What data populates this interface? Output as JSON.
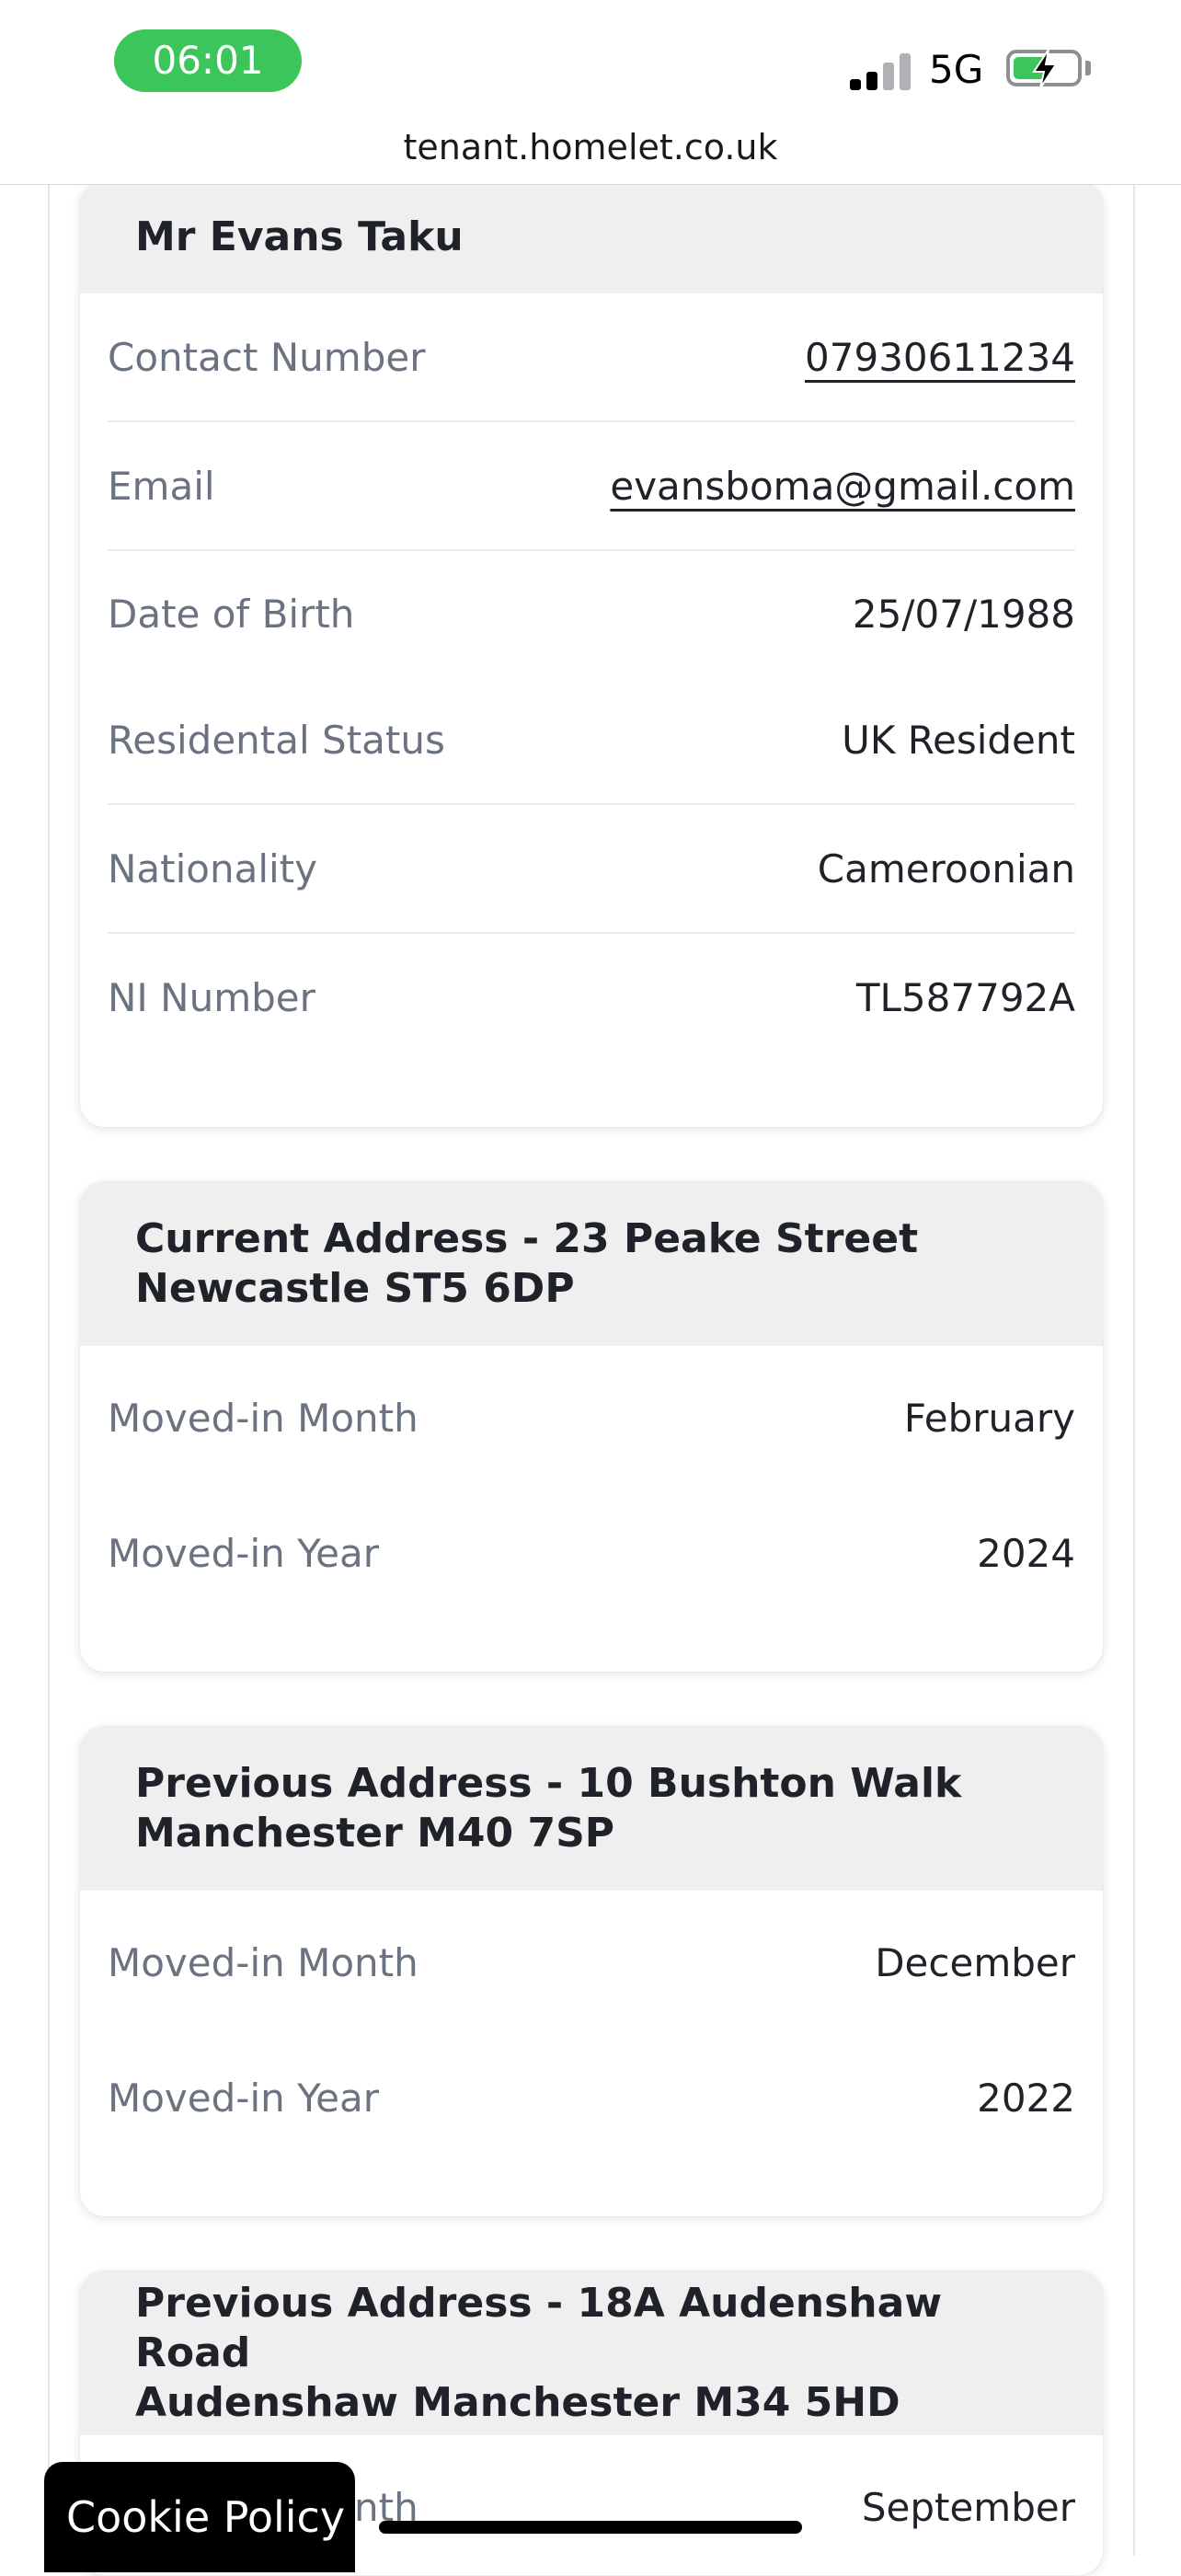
{
  "status_bar": {
    "time": "06:01",
    "network": "5G",
    "battery_percent": 55,
    "accent_color": "#3cc55a"
  },
  "browser": {
    "url": "tenant.homelet.co.uk"
  },
  "applicant": {
    "name": "Mr Evans Taku",
    "rows": [
      {
        "label": "Contact Number",
        "value": "07930611234"
      },
      {
        "label": "Email",
        "value": "evansboma@gmail.com"
      },
      {
        "label": "Date of Birth",
        "value": "25/07/1988"
      },
      {
        "label": "Residental Status",
        "value": "UK Resident"
      },
      {
        "label": "Nationality",
        "value": "Cameroonian"
      },
      {
        "label": "NI Number",
        "value": "TL587792A"
      }
    ]
  },
  "current_address": {
    "title_line1": "Current Address - 23 Peake Street",
    "title_line2": "Newcastle ST5 6DP",
    "rows": [
      {
        "label": "Moved-in Month",
        "value": "February"
      },
      {
        "label": "Moved-in Year",
        "value": "2024"
      }
    ]
  },
  "previous_address_1": {
    "title_line1": "Previous Address - 10 Bushton Walk",
    "title_line2": "Manchester M40 7SP",
    "rows": [
      {
        "label": "Moved-in Month",
        "value": "December"
      },
      {
        "label": "Moved-in Year",
        "value": "2022"
      }
    ]
  },
  "previous_address_2": {
    "title_line1": "Previous Address - 18A Audenshaw Road",
    "title_line2": "Audenshaw Manchester M34 5HD",
    "rows": [
      {
        "label": "Moved-in Month",
        "value": "September"
      }
    ]
  },
  "cookie_button": {
    "label": "Cookie Policy"
  }
}
